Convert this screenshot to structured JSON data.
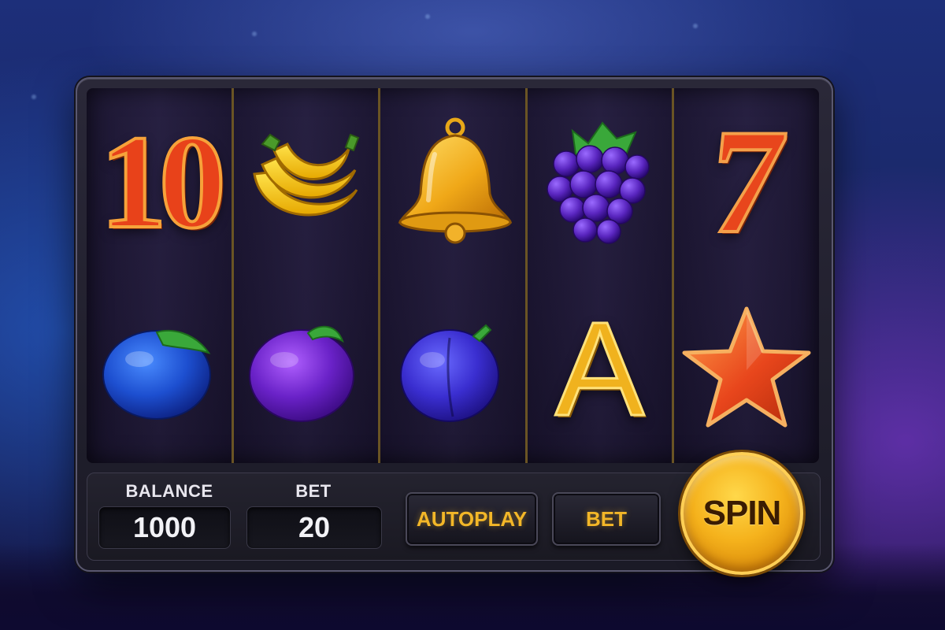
{
  "reels": [
    {
      "top": "10",
      "bottom": "blue-plum"
    },
    {
      "top": "banana",
      "bottom": "purple-plum"
    },
    {
      "top": "bell",
      "bottom": "violet-plum"
    },
    {
      "top": "grapes",
      "bottom": "A"
    },
    {
      "top": "7",
      "bottom": "star"
    }
  ],
  "symbols": {
    "ten": "10",
    "seven": "7",
    "ace": "A"
  },
  "controls": {
    "balance_label": "BALANCE",
    "balance_value": "1000",
    "bet_label": "BET",
    "bet_value": "20",
    "autoplay_label": "AUTOPLAY",
    "bet_button_label": "BET",
    "spin_label": "SPIN"
  },
  "colors": {
    "accent_gold": "#f3b728",
    "reel_divider": "#6a5424",
    "symbol_red": "#e8421a"
  },
  "icons": [
    "banana-icon",
    "bell-icon",
    "grapes-icon",
    "plum-icon",
    "star-icon"
  ]
}
